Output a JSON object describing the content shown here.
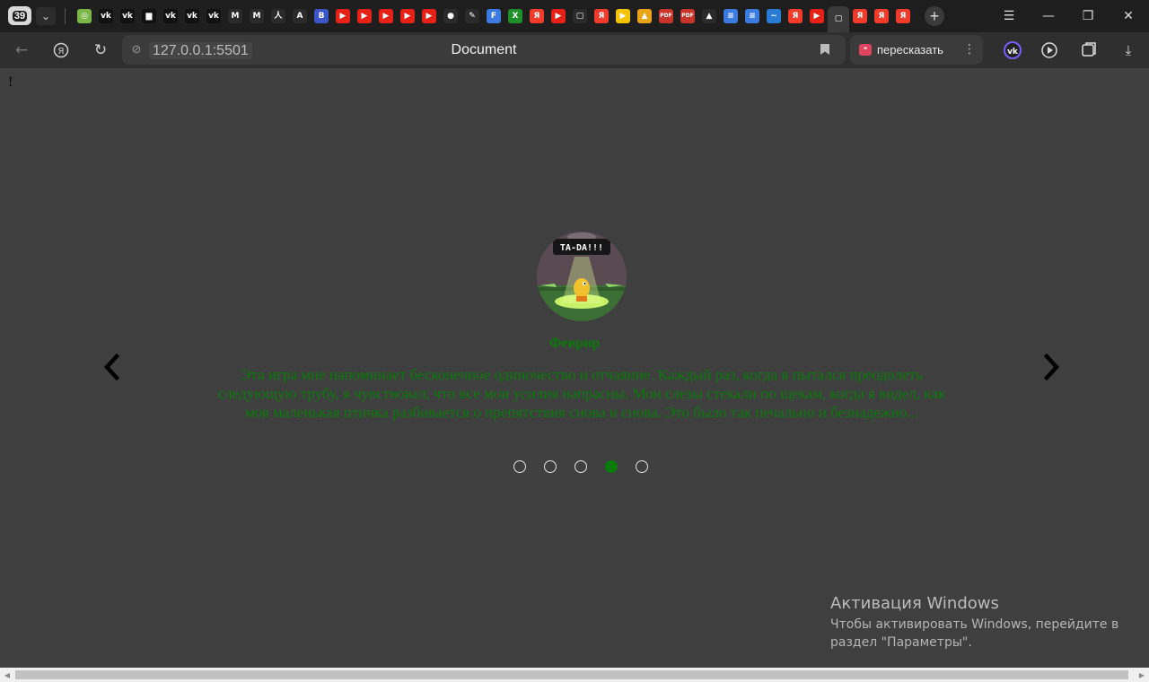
{
  "browser": {
    "tab_count": "39",
    "pinned_tabs": [
      {
        "icon": "globe-icon",
        "glyph": "◎",
        "bg": "#7ab648"
      },
      {
        "icon": "vk-icon",
        "glyph": "vk",
        "bg": "#111111"
      },
      {
        "icon": "vk-icon",
        "glyph": "vk",
        "bg": "#111111"
      },
      {
        "icon": "chat-icon",
        "glyph": "▆",
        "bg": "#111111"
      },
      {
        "icon": "vk-icon",
        "glyph": "vk",
        "bg": "#111111"
      },
      {
        "icon": "vk-icon",
        "glyph": "vk",
        "bg": "#111111"
      },
      {
        "icon": "vk-icon",
        "glyph": "vk",
        "bg": "#111111"
      },
      {
        "icon": "gmail-icon",
        "glyph": "M",
        "bg": "#2a2a2a"
      },
      {
        "icon": "gmail-icon",
        "glyph": "M",
        "bg": "#2a2a2a"
      },
      {
        "icon": "figure-icon",
        "glyph": "人",
        "bg": "#2a2a2a"
      },
      {
        "icon": "a-icon",
        "glyph": "A",
        "bg": "#2a2a2a"
      },
      {
        "icon": "b-icon",
        "glyph": "B",
        "bg": "#3b55c8"
      },
      {
        "icon": "youtube-icon",
        "glyph": "▶",
        "bg": "#e62117"
      },
      {
        "icon": "youtube-icon",
        "glyph": "▶",
        "bg": "#e62117"
      },
      {
        "icon": "youtube-icon",
        "glyph": "▶",
        "bg": "#e62117"
      },
      {
        "icon": "youtube-icon",
        "glyph": "▶",
        "bg": "#e62117"
      },
      {
        "icon": "youtube-icon",
        "glyph": "▶",
        "bg": "#e62117"
      },
      {
        "icon": "github-icon",
        "glyph": "●",
        "bg": "#2a2a2a"
      },
      {
        "icon": "pen-icon",
        "glyph": "✎",
        "bg": "#2a2a2a"
      },
      {
        "icon": "f-icon",
        "glyph": "F",
        "bg": "#3b7be0"
      },
      {
        "icon": "xbox-icon",
        "glyph": "X",
        "bg": "#1f8f2a"
      },
      {
        "icon": "yandex-icon",
        "glyph": "Я",
        "bg": "#f23b2b"
      },
      {
        "icon": "youtube-icon",
        "glyph": "▶",
        "bg": "#e62117"
      },
      {
        "icon": "page-icon",
        "glyph": "▢",
        "bg": "#2a2a2a"
      },
      {
        "icon": "yandex-icon",
        "glyph": "Я",
        "bg": "#f23b2b"
      },
      {
        "icon": "play-icon",
        "glyph": "▶",
        "bg": "#f5c400"
      },
      {
        "icon": "image-icon",
        "glyph": "▲",
        "bg": "#e8a317"
      },
      {
        "icon": "pdf-icon",
        "glyph": "PDF",
        "bg": "#c8342a"
      },
      {
        "icon": "pdf-icon",
        "glyph": "PDF",
        "bg": "#c8342a"
      },
      {
        "icon": "drive-icon",
        "glyph": "▲",
        "bg": "#2a2a2a"
      },
      {
        "icon": "docs-icon",
        "glyph": "≡",
        "bg": "#3b7be0"
      },
      {
        "icon": "docs-icon",
        "glyph": "≡",
        "bg": "#3b7be0"
      },
      {
        "icon": "wave-icon",
        "glyph": "~",
        "bg": "#2a7bd6"
      },
      {
        "icon": "yandex-icon",
        "glyph": "Я",
        "bg": "#f23b2b"
      },
      {
        "icon": "youtube-icon",
        "glyph": "▶",
        "bg": "#e62117"
      },
      {
        "icon": "document-icon",
        "glyph": "▢",
        "bg": "#3a3a3a",
        "active": true
      },
      {
        "icon": "yandex-icon",
        "glyph": "Я",
        "bg": "#f23b2b"
      },
      {
        "icon": "yandex-icon",
        "glyph": "Я",
        "bg": "#f23b2b"
      },
      {
        "icon": "yandex-icon",
        "glyph": "Я",
        "bg": "#f23b2b"
      }
    ],
    "url": "127.0.0.1:5501",
    "title": "Document",
    "retell_label": "пересказать"
  },
  "page": {
    "stray_text": "!",
    "avatar_badge": "TA-DA!!!",
    "reviewer": "Феврир",
    "review": "Эта игра мне напоминает бесконечное одиночество и отчаяние. Каждый раз, когда я пытался преодолеть следующую трубу, я чувствовал, что все мои усилия напрасны. Мои слезы стекали по щекам, когда я видел, как моя маленькая птичка разбивается о препятствия снова и снова. Это было так печально и безнадежно...",
    "slides_total": 5,
    "active_slide": 4,
    "text_color": "#0a7a0a"
  },
  "os": {
    "activation_title": "Активация Windows",
    "activation_text_1": "Чтобы активировать Windows, перейдите в",
    "activation_text_2": "раздел \"Параметры\"."
  }
}
